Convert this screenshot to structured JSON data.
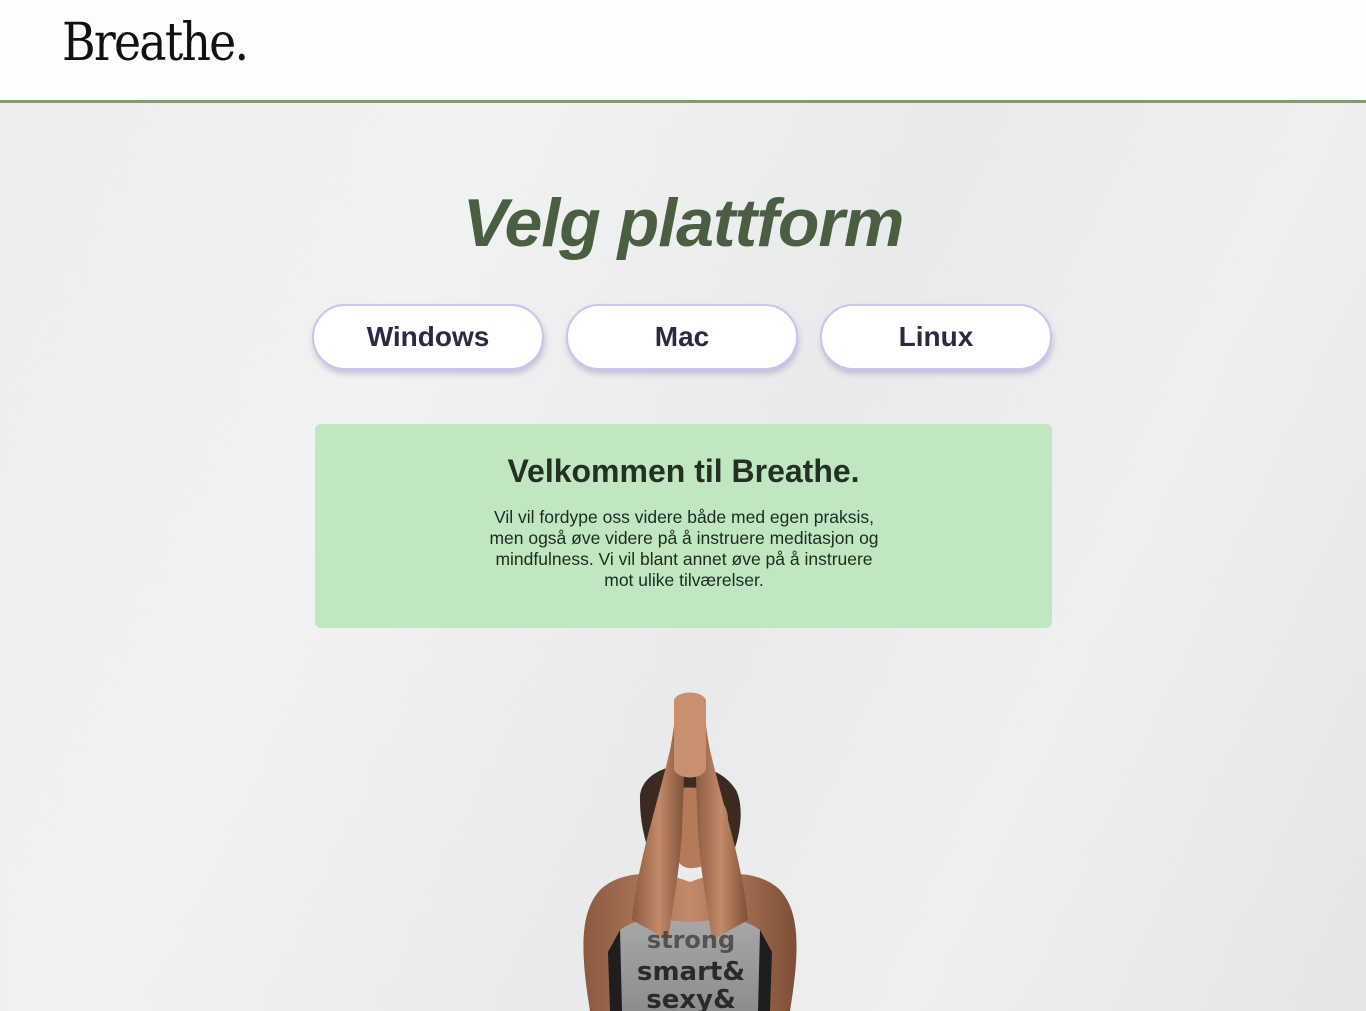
{
  "header": {
    "logo": "Breathe."
  },
  "main": {
    "title": "Velg plattform",
    "platforms": [
      {
        "label": "Windows"
      },
      {
        "label": "Mac"
      },
      {
        "label": "Linux"
      }
    ],
    "welcome": {
      "title": "Velkommen til Breathe.",
      "text": "Vil vil fordype oss videre både med egen praksis, men også øve videre på å instruere meditasjon og mindfulness. Vi vil blant annet øve på å instruere mot ulike tilværelser."
    },
    "hero_image": {
      "shirt_text": [
        "strong",
        "smart&",
        "sexy&"
      ]
    }
  },
  "colors": {
    "header_border": "#7d9a72",
    "title": "#4a5e42",
    "button_border": "#c9c4ee",
    "card_bg": "#c1e6c2"
  }
}
